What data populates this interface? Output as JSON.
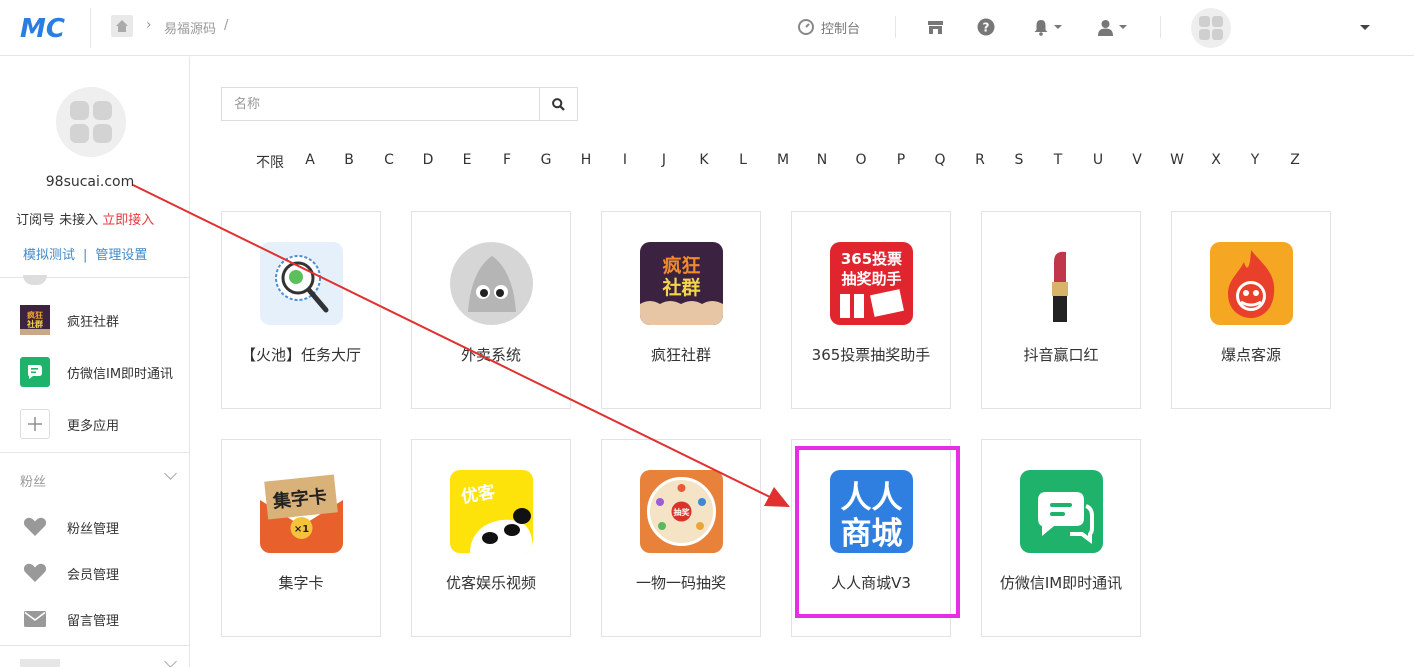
{
  "header": {
    "breadcrumb_text": "易福源码",
    "breadcrumb_slash": "/",
    "console_label": "控制台"
  },
  "account": {
    "name": "98sucai.com",
    "status_prefix": "订阅号 未接入",
    "status_link": "立即接入",
    "link_test": "模拟测试",
    "link_sep": "|",
    "link_settings": "管理设置"
  },
  "sidebar": {
    "apps": [
      {
        "label": "疯狂社群",
        "icon": "crazy-community-icon"
      },
      {
        "label": "仿微信IM即时通讯",
        "icon": "wechat-im-icon"
      },
      {
        "label": "更多应用",
        "icon": "plus-icon"
      }
    ],
    "fans_section": "粉丝",
    "fans_items": [
      {
        "label": "粉丝管理",
        "icon": "heart-icon"
      },
      {
        "label": "会员管理",
        "icon": "heart-icon"
      },
      {
        "label": "留言管理",
        "icon": "envelope-icon"
      }
    ]
  },
  "search": {
    "placeholder": "名称"
  },
  "alphabet": [
    "不限",
    "A",
    "B",
    "C",
    "D",
    "E",
    "F",
    "G",
    "H",
    "I",
    "J",
    "K",
    "L",
    "M",
    "N",
    "O",
    "P",
    "Q",
    "R",
    "S",
    "T",
    "U",
    "V",
    "W",
    "X",
    "Y",
    "Z"
  ],
  "apps": [
    {
      "label": "【火池】任务大厅",
      "icon": "task-hall-icon"
    },
    {
      "label": "外卖系统",
      "icon": "takeout-icon"
    },
    {
      "label": "疯狂社群",
      "icon": "crazy-community-icon",
      "icon_text_1": "疯狂",
      "icon_text_2": "社群"
    },
    {
      "label": "365投票抽奖助手",
      "icon": "vote-lottery-icon",
      "icon_text_1": "365投票",
      "icon_text_2": "抽奖助手"
    },
    {
      "label": "抖音赢口红",
      "icon": "lipstick-icon"
    },
    {
      "label": "爆点客源",
      "icon": "fire-customers-icon"
    },
    {
      "label": "集字卡",
      "icon": "word-card-icon",
      "icon_text_1": "集字卡",
      "icon_text_2": "×1"
    },
    {
      "label": "优客娱乐视频",
      "icon": "youke-video-icon",
      "icon_text_1": "优客"
    },
    {
      "label": "一物一码抽奖",
      "icon": "qrcode-lottery-icon",
      "icon_text_1": "抽奖"
    },
    {
      "label": "人人商城V3",
      "icon": "renren-mall-icon",
      "icon_text_1": "人人",
      "icon_text_2": "商城"
    },
    {
      "label": "仿微信IM即时通讯",
      "icon": "wechat-im-icon"
    }
  ],
  "colors": {
    "brand_blue": "#2a7de1",
    "link_blue": "#428bca",
    "link_red": "#e4393c",
    "highlight_magenta": "#e62ee6",
    "arrow_red": "#e03030"
  }
}
